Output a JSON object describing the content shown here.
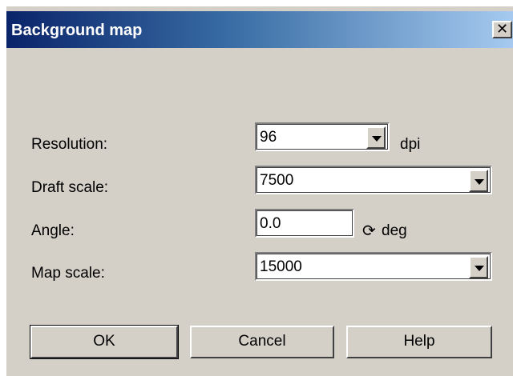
{
  "window": {
    "title": "Background map",
    "close_glyph": "✕"
  },
  "form": {
    "resolution": {
      "label": "Resolution:",
      "value": "96",
      "unit": "dpi"
    },
    "draft_scale": {
      "label": "Draft scale:",
      "value": "7500"
    },
    "angle": {
      "label": "Angle:",
      "value": "0.0",
      "unit": "deg",
      "unit_icon": "rotate-icon",
      "icon_glyph": "⟳"
    },
    "map_scale": {
      "label": "Map scale:",
      "value": "15000"
    }
  },
  "buttons": {
    "ok": "OK",
    "cancel": "Cancel",
    "help": "Help"
  }
}
